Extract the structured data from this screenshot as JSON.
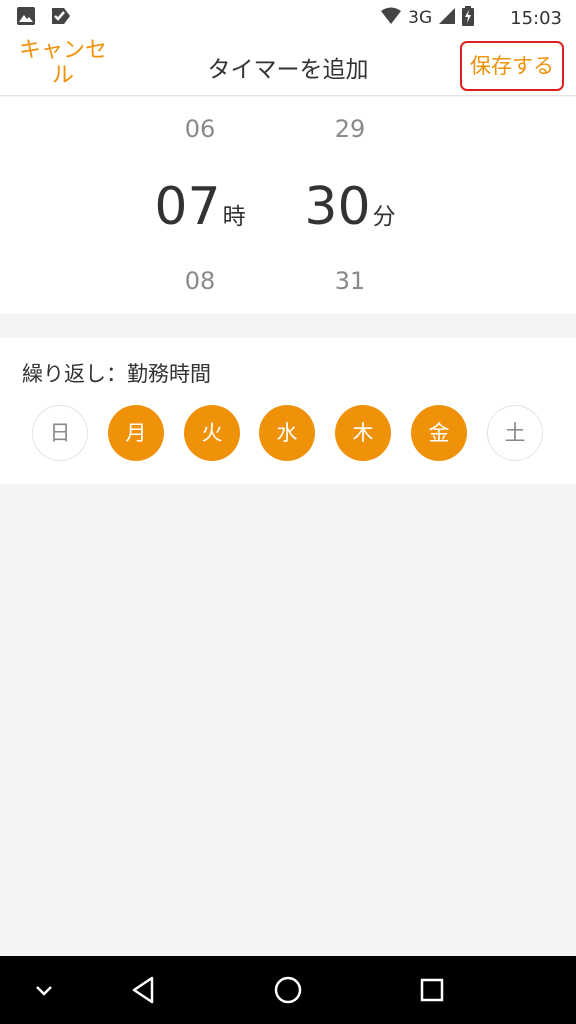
{
  "status_bar": {
    "network": "3G",
    "time": "15:03",
    "icons": [
      "image-icon",
      "check-notification-icon",
      "wifi-icon",
      "signal-icon",
      "battery-charging-icon"
    ]
  },
  "header": {
    "cancel_label": "キャンセル",
    "title": "タイマーを追加",
    "save_label": "保存する",
    "accent_color": "#f0910a"
  },
  "time_picker": {
    "hour": {
      "prev": "06",
      "current": "07",
      "next": "08",
      "unit": "時"
    },
    "minute": {
      "prev": "29",
      "current": "30",
      "next": "31",
      "unit": "分"
    }
  },
  "repeat": {
    "label": "繰り返し：勤務時間",
    "days": [
      {
        "label": "日",
        "selected": false
      },
      {
        "label": "月",
        "selected": true
      },
      {
        "label": "火",
        "selected": true
      },
      {
        "label": "水",
        "selected": true
      },
      {
        "label": "木",
        "selected": true
      },
      {
        "label": "金",
        "selected": true
      },
      {
        "label": "土",
        "selected": false
      }
    ]
  },
  "nav_bar": {
    "icons": [
      "chevron-down-icon",
      "back-icon",
      "home-icon",
      "recents-icon"
    ]
  }
}
